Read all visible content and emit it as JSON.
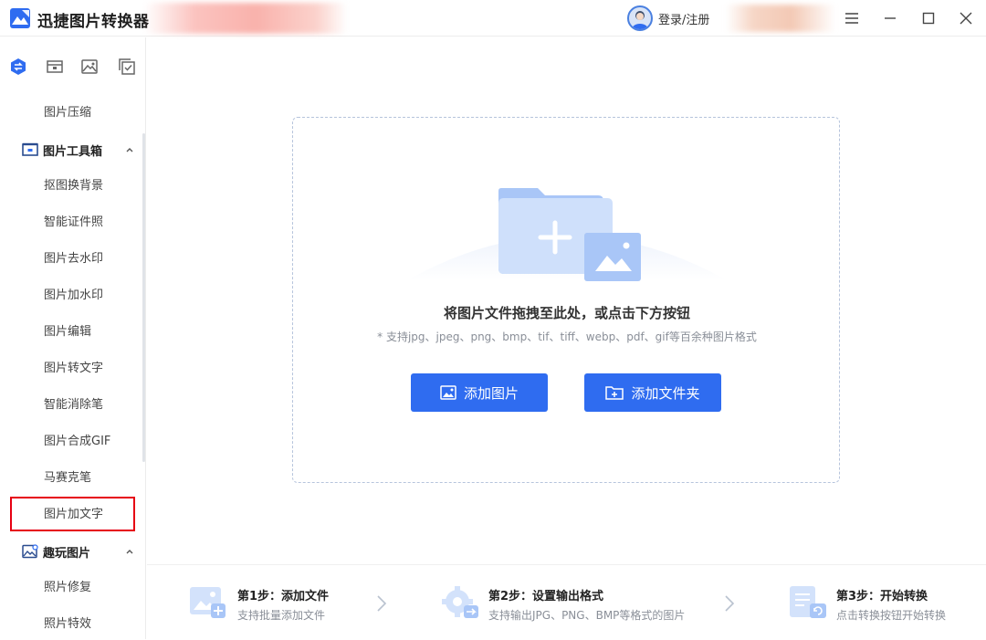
{
  "app": {
    "title": "迅捷图片转换器",
    "login_label": "登录/注册"
  },
  "window_controls": [
    "menu-icon",
    "minimize-icon",
    "maximize-icon",
    "close-icon"
  ],
  "sidebar": {
    "tabs": [
      "convert-icon",
      "toolbox-icon",
      "image-icon",
      "batch-icon"
    ],
    "top_item": "图片压缩",
    "groups": [
      {
        "label": "图片工具箱",
        "icon": "toolbox-icon",
        "expanded": true,
        "items": [
          "抠图换背景",
          "智能证件照",
          "图片去水印",
          "图片加水印",
          "图片编辑",
          "图片转文字",
          "智能消除笔",
          "图片合成GIF",
          "马赛克笔",
          "图片加文字"
        ]
      },
      {
        "label": "趣玩图片",
        "icon": "fun-image-icon",
        "expanded": true,
        "items": [
          "照片修复",
          "照片特效"
        ]
      }
    ],
    "selected_item": "图片加文字"
  },
  "dropzone": {
    "title": "将图片文件拖拽至此处，或点击下方按钮",
    "subtitle": "* 支持jpg、jpeg、png、bmp、tif、tiff、webp、pdf、gif等百余种图片格式",
    "add_image_label": "添加图片",
    "add_folder_label": "添加文件夹"
  },
  "steps": [
    {
      "title": "第1步：添加文件",
      "desc": "支持批量添加文件"
    },
    {
      "title": "第2步：设置输出格式",
      "desc": "支持输出JPG、PNG、BMP等格式的图片"
    },
    {
      "title": "第3步：开始转换",
      "desc": "点击转换按钮开始转换"
    }
  ],
  "colors": {
    "accent": "#2f6cf0",
    "highlight_border": "#e60012",
    "folder_light": "#cfe0fb",
    "folder_dark": "#a9c6f7"
  }
}
